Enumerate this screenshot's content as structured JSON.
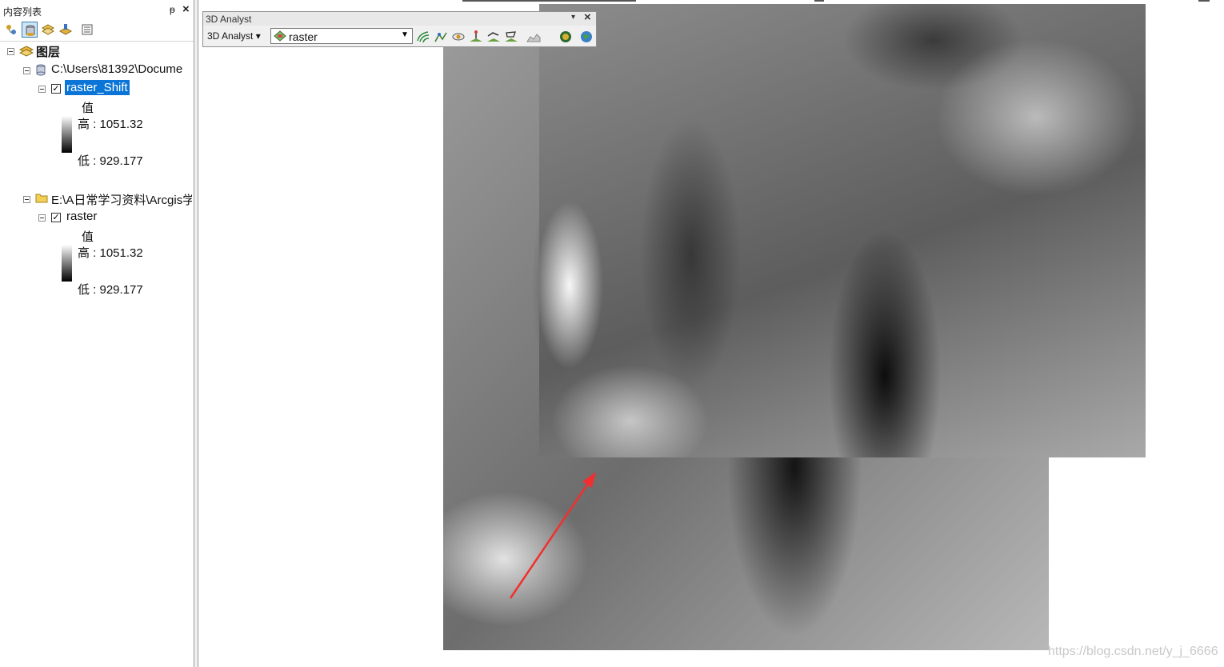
{
  "toc": {
    "title": "内容列表",
    "pin_glyph": "ᵽ",
    "close_glyph": "×",
    "toolbar_icons": [
      "list-by-drawing-order-icon",
      "list-by-source-icon",
      "list-by-visibility-icon",
      "list-by-selection-icon",
      "options-icon"
    ],
    "root_label": "图层",
    "groups": [
      {
        "path": "C:\\Users\\81392\\Docume",
        "layer": "raster_Shift",
        "checked": true,
        "selected": true,
        "legend_title": "值",
        "high": "高 : 1051.32",
        "low": "低 : 929.177"
      },
      {
        "path": "E:\\A日常学习资料\\Arcgis学",
        "layer": "raster",
        "checked": true,
        "selected": false,
        "legend_title": "值",
        "high": "高 : 1051.32",
        "low": "低 : 929.177"
      }
    ]
  },
  "analyst_toolbar": {
    "title": "3D Analyst",
    "menu_label": "3D Analyst ▾",
    "selected_layer": "raster",
    "close_glyph": "×",
    "dropdown_glyph": "▾",
    "select_arrow": "▼",
    "tools": [
      "contour-icon",
      "steepest-path-icon",
      "line-of-sight-icon",
      "interpolate-point-icon",
      "interpolate-line-icon",
      "interpolate-polygon-icon",
      "profile-graph-icon",
      "arcscene-icon",
      "arcglobe-icon"
    ]
  },
  "watermark": "https://blog.csdn.net/y_j_6666",
  "colors": {
    "selection": "#0a75d6",
    "arrow": "#f03030"
  }
}
